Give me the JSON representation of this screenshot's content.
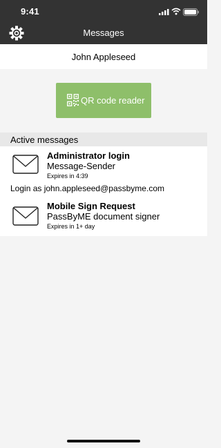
{
  "status_bar": {
    "time": "9:41"
  },
  "nav": {
    "title": "Messages",
    "settings_icon": "gear-icon"
  },
  "user": {
    "name": "John Appleseed"
  },
  "qr_button": {
    "label": "QR code reader",
    "icon": "qr-code-icon",
    "color": "#8ebf6a"
  },
  "section": {
    "title": "Active messages"
  },
  "messages": [
    {
      "icon": "envelope-icon",
      "title": "Administrator login",
      "sender": "Message-Sender",
      "expires": "Expires in 4:39",
      "detail": "Login as john.appleseed@passbyme.com"
    },
    {
      "icon": "envelope-icon",
      "title": "Mobile Sign Request",
      "sender": "PassByME document signer",
      "expires": "Expires in 1+ day"
    }
  ],
  "colors": {
    "header": "#333333",
    "background": "#f4f4f4",
    "section_header": "#e8e8e8"
  }
}
